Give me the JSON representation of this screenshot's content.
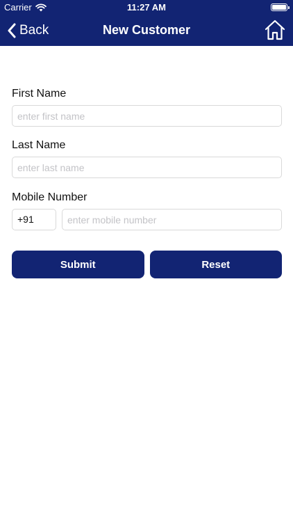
{
  "status_bar": {
    "carrier": "Carrier",
    "time": "11:27 AM",
    "wifi_icon": "wifi-icon",
    "battery_icon": "battery-icon"
  },
  "nav": {
    "back_label": "Back",
    "title": "New Customer",
    "back_icon": "chevron-left-icon",
    "home_icon": "home-icon",
    "bar_color": "#122473"
  },
  "form": {
    "first_name": {
      "label": "First Name",
      "value": "",
      "placeholder": "enter first name"
    },
    "last_name": {
      "label": "Last Name",
      "value": "",
      "placeholder": "enter last name"
    },
    "mobile": {
      "label": "Mobile Number",
      "country_code": "+91",
      "value": "",
      "placeholder": "enter mobile number"
    }
  },
  "actions": {
    "submit_label": "Submit",
    "reset_label": "Reset",
    "button_color": "#122473"
  }
}
